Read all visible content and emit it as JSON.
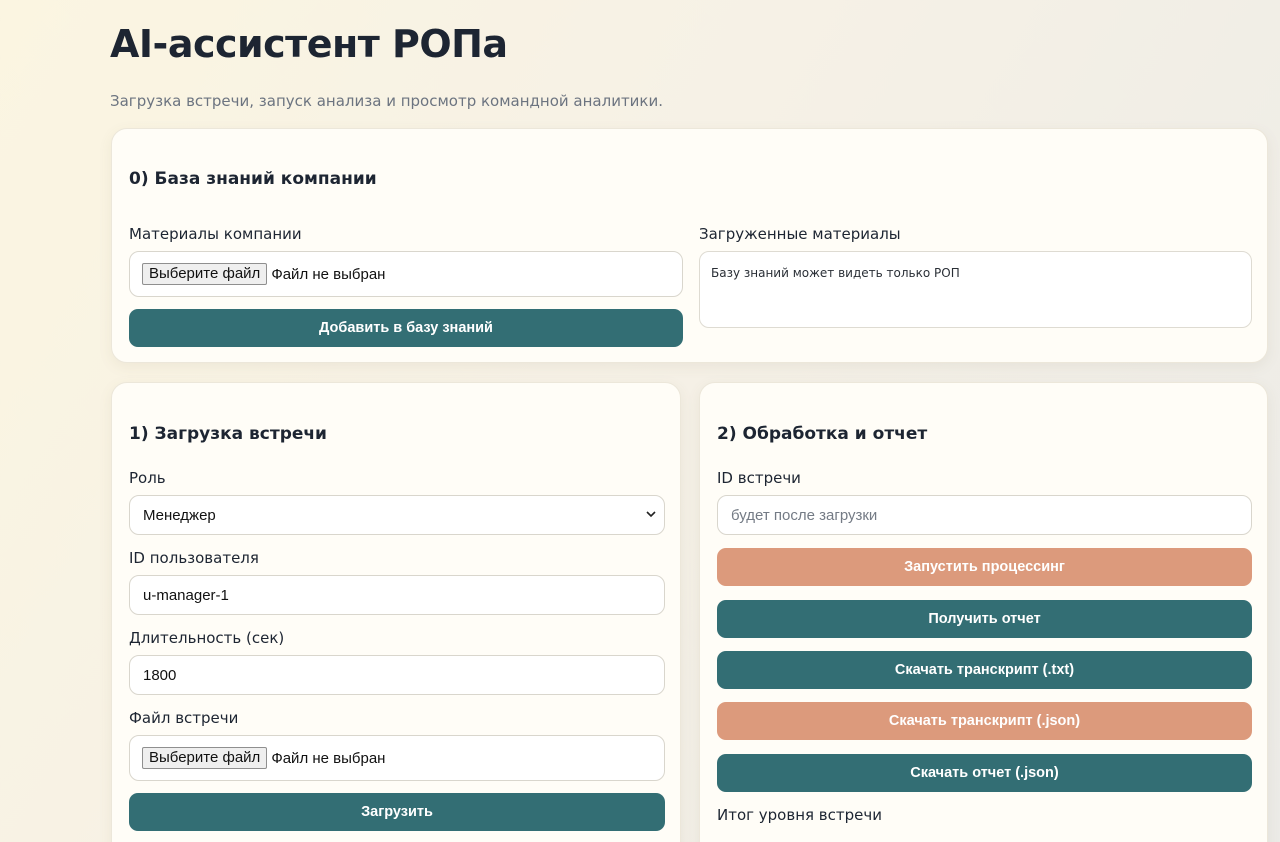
{
  "header": {
    "title": "AI-ассистент РОПа",
    "subtitle": "Загрузка встречи, запуск анализа и просмотр командной аналитики."
  },
  "knowledge_base": {
    "title": "0) База знаний компании",
    "materials_label": "Материалы компании",
    "file_button": "Выберите файл",
    "file_status": "Файл не выбран",
    "add_button": "Добавить в базу знаний",
    "uploaded_label": "Загруженные материалы",
    "uploaded_text": "Базу знаний может видеть только РОП"
  },
  "upload": {
    "title": "1) Загрузка встречи",
    "role_label": "Роль",
    "role_value": "Менеджер",
    "user_id_label": "ID пользователя",
    "user_id_value": "u-manager-1",
    "duration_label": "Длительность (сек)",
    "duration_value": "1800",
    "file_label": "Файл встречи",
    "file_button": "Выберите файл",
    "file_status": "Файл не выбран",
    "submit_button": "Загрузить"
  },
  "processing": {
    "title": "2) Обработка и отчет",
    "meeting_id_label": "ID встречи",
    "meeting_id_placeholder": "будет после загрузки",
    "buttons": {
      "run": "Запустить процессинг",
      "get_report": "Получить отчет",
      "download_txt": "Скачать транскрипт (.txt)",
      "download_json": "Скачать транскрипт (.json)",
      "download_report": "Скачать отчет (.json)"
    },
    "summary_label": "Итог уровня встречи"
  },
  "colors": {
    "teal": "#336e74",
    "peach": "#dc9a7c"
  }
}
